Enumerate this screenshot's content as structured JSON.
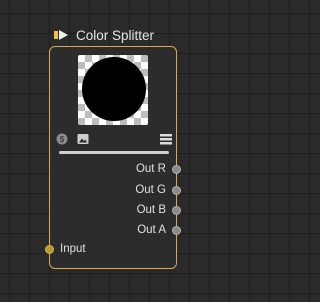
{
  "node": {
    "title": "Color Splitter",
    "title_icon": "arrow-icon",
    "preview_icon": "image-preview",
    "toolbar": {
      "left_icon": "dollar-icon",
      "middle_icon": "image-icon",
      "right_icon": "layers-icon"
    },
    "slider_value": 1.0,
    "outputs": [
      "Out R",
      "Out G",
      "Out B",
      "Out A"
    ],
    "inputs": [
      "Input"
    ]
  },
  "colors": {
    "accent": "#e0a652",
    "node_bg": "#2c2c2c",
    "canvas_bg": "#2a2a2a",
    "input_port": "#b59a2c"
  }
}
